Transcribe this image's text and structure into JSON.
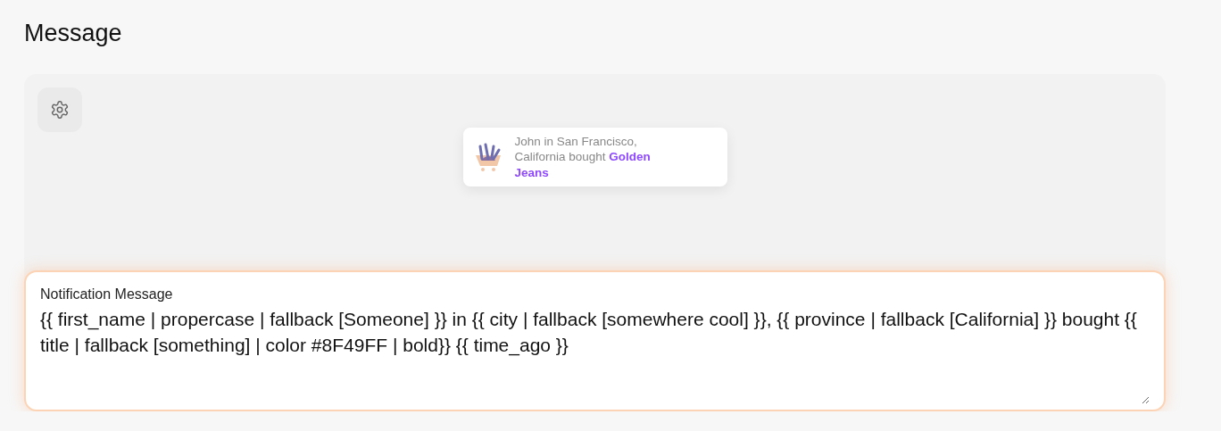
{
  "heading": "Message",
  "preview": {
    "notification": {
      "message": "John in San Francisco, California bought **Golden Jeans**"
    }
  },
  "message_field": {
    "label": "Notification Message",
    "value": "{{ first_name | propercase | fallback [Someone] }} in {{ city | fallback [somewhere cool] }}, {{ province | fallback [California] }} bought {{ title | fallback [something] | color #8F49FF | bold}} {{ time_ago }}",
    "focused": true
  }
}
